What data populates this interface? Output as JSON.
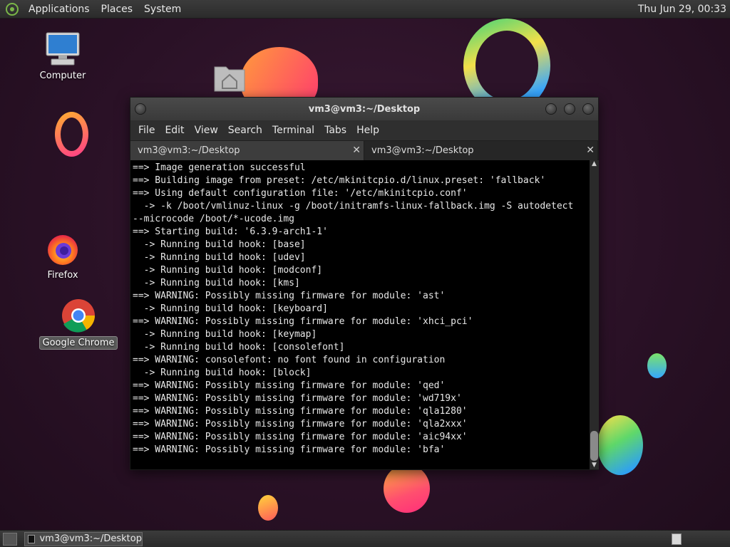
{
  "top_panel": {
    "menus": [
      "Applications",
      "Places",
      "System"
    ],
    "clock": "Thu Jun 29, 00:33"
  },
  "desktop_icons": {
    "computer": "Computer",
    "firefox": "Firefox",
    "chrome": "Google Chrome"
  },
  "window": {
    "title": "vm3@vm3:~/Desktop",
    "menu": [
      "File",
      "Edit",
      "View",
      "Search",
      "Terminal",
      "Tabs",
      "Help"
    ],
    "tabs": [
      {
        "label": "vm3@vm3:~/Desktop",
        "close": "✕"
      },
      {
        "label": "vm3@vm3:~/Desktop",
        "close": "✕"
      }
    ],
    "terminal_lines": [
      "==> Image generation successful",
      "==> Building image from preset: /etc/mkinitcpio.d/linux.preset: 'fallback'",
      "==> Using default configuration file: '/etc/mkinitcpio.conf'",
      "  -> -k /boot/vmlinuz-linux -g /boot/initramfs-linux-fallback.img -S autodetect",
      "--microcode /boot/*-ucode.img",
      "==> Starting build: '6.3.9-arch1-1'",
      "  -> Running build hook: [base]",
      "  -> Running build hook: [udev]",
      "  -> Running build hook: [modconf]",
      "  -> Running build hook: [kms]",
      "==> WARNING: Possibly missing firmware for module: 'ast'",
      "  -> Running build hook: [keyboard]",
      "==> WARNING: Possibly missing firmware for module: 'xhci_pci'",
      "  -> Running build hook: [keymap]",
      "  -> Running build hook: [consolefont]",
      "==> WARNING: consolefont: no font found in configuration",
      "  -> Running build hook: [block]",
      "==> WARNING: Possibly missing firmware for module: 'qed'",
      "==> WARNING: Possibly missing firmware for module: 'wd719x'",
      "==> WARNING: Possibly missing firmware for module: 'qla1280'",
      "==> WARNING: Possibly missing firmware for module: 'qla2xxx'",
      "==> WARNING: Possibly missing firmware for module: 'aic94xx'",
      "==> WARNING: Possibly missing firmware for module: 'bfa'"
    ]
  },
  "taskbar": {
    "task_label": "vm3@vm3:~/Desktop"
  },
  "icons": {
    "distro_logo": "distro-logo-icon",
    "computer": "monitor-icon",
    "home_folder": "home-folder-icon",
    "firefox": "firefox-icon",
    "chrome": "chrome-icon",
    "terminal": "terminal-icon"
  }
}
